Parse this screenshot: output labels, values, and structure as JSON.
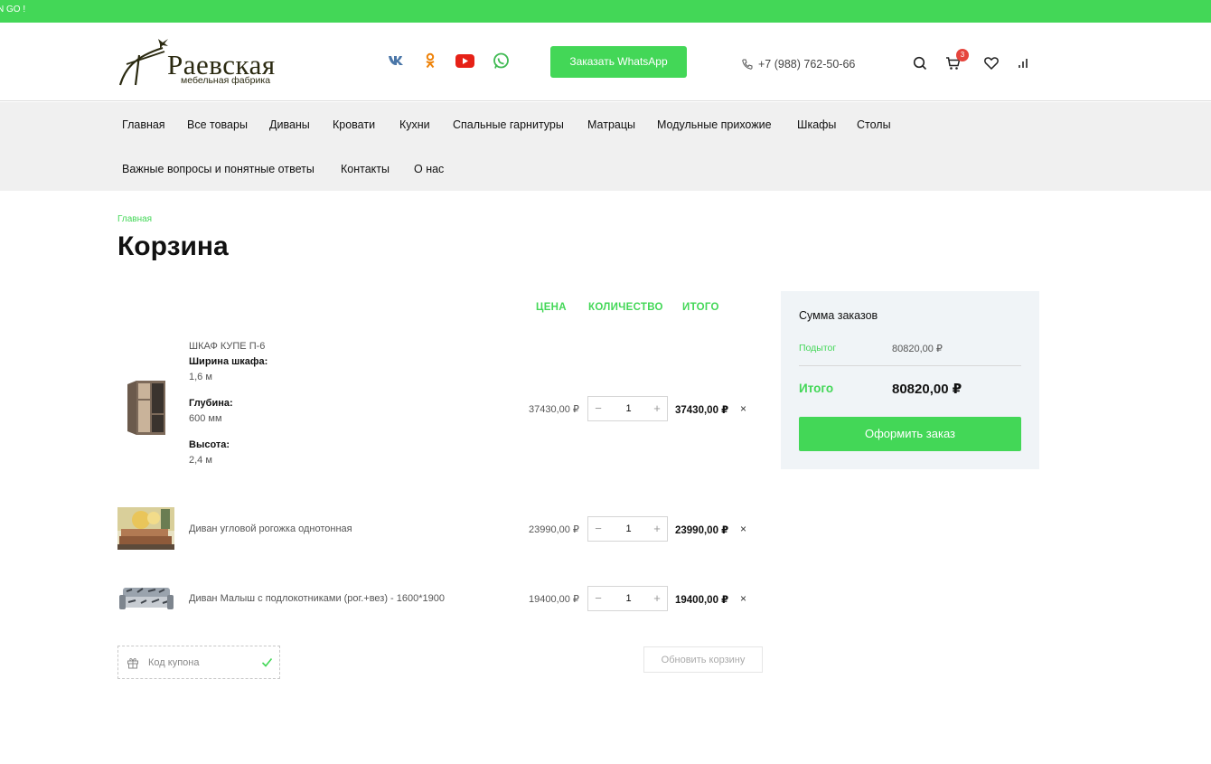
{
  "topbar": {
    "text": "N GO !"
  },
  "logo": {
    "title": "Раевская",
    "subtitle": "мебельная фабрика"
  },
  "header": {
    "social": [
      "vk-icon",
      "ok-icon",
      "youtube-icon",
      "whatsapp-icon"
    ],
    "whatsapp_button": "Заказать WhatsApp",
    "phone": "+7 (988) 762-50-66",
    "cart_count": "3"
  },
  "nav": {
    "items": [
      "Главная",
      "Все товары",
      "Диваны",
      "Кровати",
      "Кухни",
      "Спальные гарнитуры",
      "Матрацы",
      "Модульные прихожие",
      "Шкафы",
      "Столы",
      "Важные вопросы и понятные ответы",
      "Контакты",
      "О нас"
    ]
  },
  "breadcrumb": "Главная",
  "page_title": "Корзина",
  "table": {
    "col_price": "ЦЕНА",
    "col_qty": "КОЛИЧЕСТВО",
    "col_total": "ИТОГО",
    "items": [
      {
        "name": "ШКАФ КУПЕ П-6",
        "attrs": [
          {
            "label": "Ширина шкафа:",
            "value": "1,6 м"
          },
          {
            "label": "Глубина:",
            "value": "600 мм"
          },
          {
            "label": "Высота:",
            "value": "2,4 м"
          }
        ],
        "price": "37430,00 ₽",
        "qty": "1",
        "total": "37430,00 ₽"
      },
      {
        "name": "Диван угловой рогожка однотонная",
        "price": "23990,00 ₽",
        "qty": "1",
        "total": "23990,00 ₽"
      },
      {
        "name": "Диван Малыш с подлокотниками (рог.+вез) - 1600*1900",
        "price": "19400,00 ₽",
        "qty": "1",
        "total": "19400,00 ₽"
      }
    ],
    "qty_minus": "−",
    "qty_plus": "+",
    "remove": "×"
  },
  "coupon": {
    "placeholder": "Код купона"
  },
  "update_button": "Обновить корзину",
  "summary": {
    "title": "Сумма заказов",
    "subtotal_label": "Подытог",
    "subtotal_value": "80820,00 ₽",
    "total_label": "Итого",
    "total_value": "80820,00 ₽",
    "checkout_button": "Оформить заказ"
  },
  "colors": {
    "accent": "#43d757",
    "badge": "#e5453d",
    "summary_bg": "#f0f4f7",
    "nav_bg": "#f0f0f0"
  }
}
